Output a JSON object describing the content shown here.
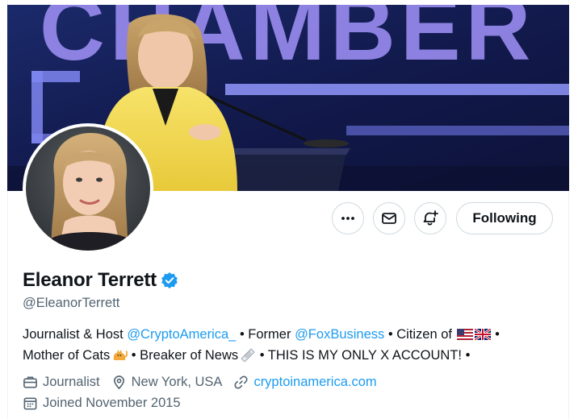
{
  "banner": {
    "backdrop_text": "CHAMBER",
    "colors": {
      "background": "#16205a",
      "letters": "#9a8cf0",
      "lights": "#6f78e8"
    }
  },
  "avatar": {
    "icon": "profile-photo"
  },
  "actions": {
    "more_icon": "more-icon",
    "message_icon": "envelope-icon",
    "notify_icon": "bell-plus-icon",
    "following_label": "Following"
  },
  "profile": {
    "name": "Eleanor Terrett",
    "verified_icon": "verified-badge-icon",
    "handle": "@EleanorTerrett",
    "bio": {
      "line1": {
        "part1": "Journalist & Host ",
        "mention1": "@CryptoAmerica_",
        "part2": " • Former ",
        "mention2": "@FoxBusiness",
        "part3": " • Citizen of ",
        "flags": [
          "us-flag",
          "uk-flag"
        ],
        "part4": " •"
      },
      "line2": {
        "part1": "Mother of Cats",
        "cat_emoji": "cat-emoji",
        "part2": " • Breaker of News",
        "news_emoji": "newspaper-emoji",
        "part3": " • THIS IS MY ONLY X ACCOUNT! •"
      }
    },
    "meta": {
      "profession": "Journalist",
      "location": "New York, USA",
      "website": "cryptoinamerica.com",
      "joined": "Joined November 2015"
    }
  },
  "colors": {
    "accent": "#1d9bf0",
    "muted": "#536471",
    "text": "#0f1419"
  }
}
